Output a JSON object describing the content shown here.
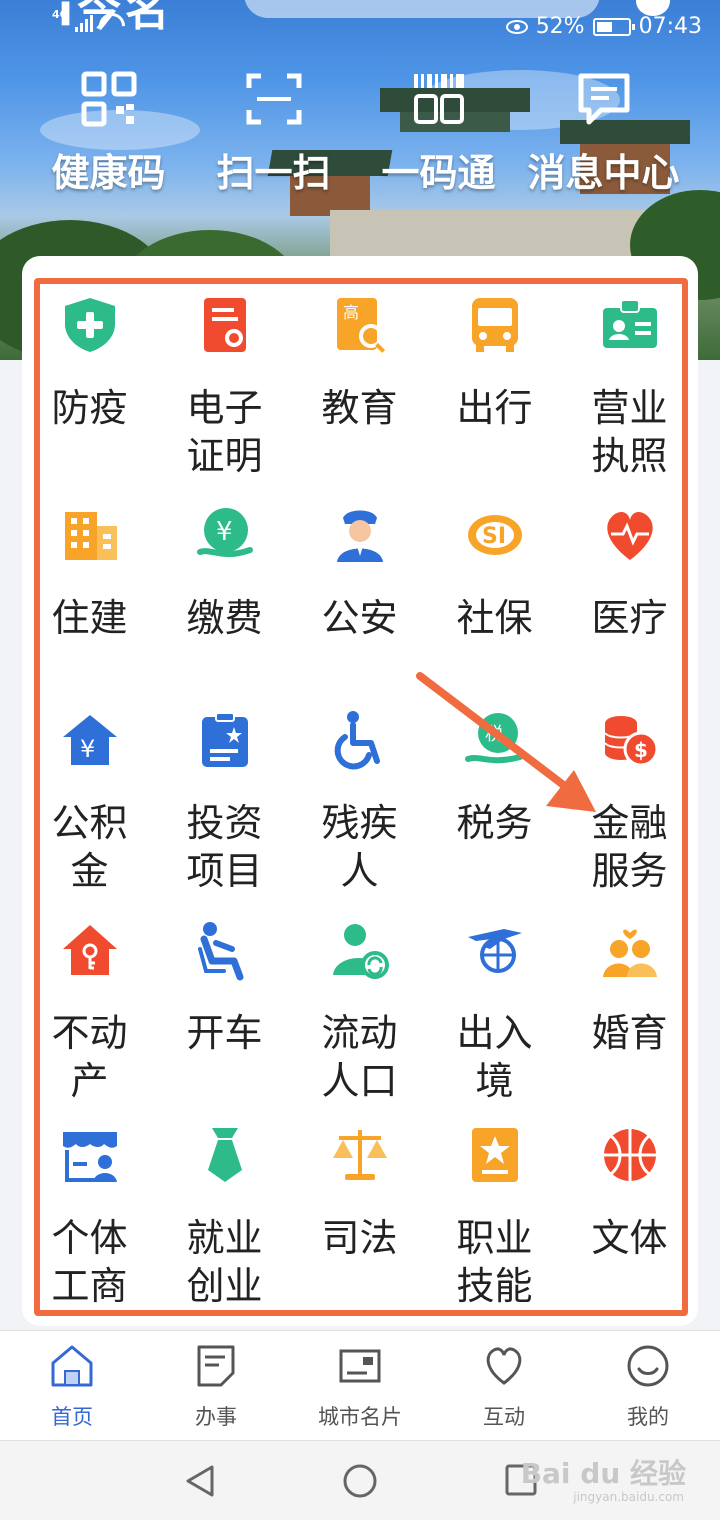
{
  "status_bar": {
    "network": "4G",
    "battery": "52%",
    "battery_level": 0.52,
    "time": "07:43"
  },
  "header": {
    "app_title": "i今名",
    "quick_actions": [
      {
        "label": "健康码",
        "icon": "qr-code-icon"
      },
      {
        "label": "扫一扫",
        "icon": "scan-icon"
      },
      {
        "label": "一码通",
        "icon": "barcode-icon"
      },
      {
        "label": "消息中心",
        "icon": "message-icon"
      }
    ]
  },
  "services": [
    {
      "label": "防疫",
      "icon": "shield-plus-icon",
      "color": "#2dbb8a"
    },
    {
      "label": "电子证明",
      "icon": "certificate-icon",
      "color": "#f04a2f"
    },
    {
      "label": "教育",
      "icon": "education-icon",
      "color": "#f7a428"
    },
    {
      "label": "出行",
      "icon": "bus-icon",
      "color": "#f7a428"
    },
    {
      "label": "营业执照",
      "icon": "license-card-icon",
      "color": "#2dbb8a"
    },
    {
      "label": "住建",
      "icon": "building-icon",
      "color": "#f7a428"
    },
    {
      "label": "缴费",
      "icon": "yuan-hand-icon",
      "color": "#2dbb8a"
    },
    {
      "label": "公安",
      "icon": "police-icon",
      "color": "#2f6fd8"
    },
    {
      "label": "社保",
      "icon": "social-security-icon",
      "color": "#f7a428"
    },
    {
      "label": "医疗",
      "icon": "heart-pulse-icon",
      "color": "#f04a2f"
    },
    {
      "label": "公积金",
      "icon": "house-yuan-icon",
      "color": "#2f6fd8"
    },
    {
      "label": "投资项目",
      "icon": "clipboard-star-icon",
      "color": "#2f6fd8"
    },
    {
      "label": "残疾人",
      "icon": "wheelchair-icon",
      "color": "#2f6fd8"
    },
    {
      "label": "税务",
      "icon": "tax-icon",
      "color": "#2dbb8a"
    },
    {
      "label": "金融服务",
      "icon": "coins-icon",
      "color": "#f04a2f"
    },
    {
      "label": "不动产",
      "icon": "house-key-icon",
      "color": "#f04a2f"
    },
    {
      "label": "开车",
      "icon": "driver-icon",
      "color": "#2f6fd8"
    },
    {
      "label": "流动人口",
      "icon": "person-refresh-icon",
      "color": "#2dbb8a"
    },
    {
      "label": "出入境",
      "icon": "plane-globe-icon",
      "color": "#2f6fd8"
    },
    {
      "label": "婚育",
      "icon": "couple-icon",
      "color": "#f7a428"
    },
    {
      "label": "个体工商",
      "icon": "shop-icon",
      "color": "#2f6fd8"
    },
    {
      "label": "就业创业",
      "icon": "tie-icon",
      "color": "#2dbb8a"
    },
    {
      "label": "司法",
      "icon": "scales-icon",
      "color": "#f7a428"
    },
    {
      "label": "职业技能",
      "icon": "badge-star-icon",
      "color": "#f7a428"
    },
    {
      "label": "文体",
      "icon": "basketball-icon",
      "color": "#f04a2f"
    }
  ],
  "bottom_nav": [
    {
      "label": "首页",
      "icon": "home-icon",
      "active": true
    },
    {
      "label": "办事",
      "icon": "document-icon",
      "active": false
    },
    {
      "label": "城市名片",
      "icon": "city-card-icon",
      "active": false
    },
    {
      "label": "互动",
      "icon": "heart-icon",
      "active": false
    },
    {
      "label": "我的",
      "icon": "smile-icon",
      "active": false
    }
  ],
  "watermark": {
    "text": "Bai du 经验",
    "sub": "jingyan.baidu.com"
  },
  "colors": {
    "highlight": "#f06b3f",
    "accent": "#3568d4"
  }
}
